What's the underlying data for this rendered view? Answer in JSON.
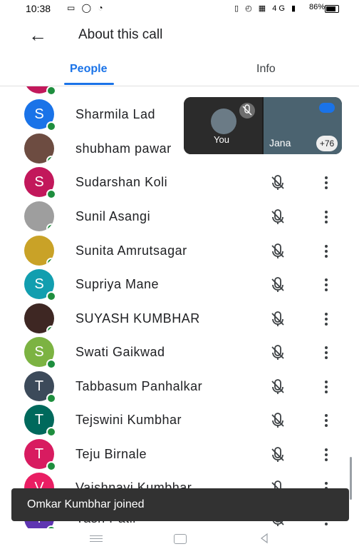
{
  "status_bar": {
    "time": "10:38",
    "battery": "86%",
    "network": "4G"
  },
  "header": {
    "title": "About this call"
  },
  "tabs": [
    {
      "label": "People",
      "active": true
    },
    {
      "label": "Info",
      "active": false
    }
  ],
  "participants": [
    {
      "initial": "",
      "name": "",
      "color": "#c2185b",
      "partial": true
    },
    {
      "initial": "S",
      "name": "Sharmila Lad",
      "color": "#1a73e8"
    },
    {
      "initial": "",
      "name": "shubham pawar",
      "color": "#6d4c41",
      "photo": true
    },
    {
      "initial": "S",
      "name": "Sudarshan Koli",
      "color": "#c2185b"
    },
    {
      "initial": "",
      "name": "Sunil Asangi",
      "color": "#9e9e9e",
      "photo": true
    },
    {
      "initial": "",
      "name": "Sunita Amrutsagar",
      "color": "#c9a227",
      "photo": true
    },
    {
      "initial": "S",
      "name": "Supriya Mane",
      "color": "#129eaf"
    },
    {
      "initial": "",
      "name": "SUYASH KUMBHAR",
      "color": "#3e2723",
      "photo": true
    },
    {
      "initial": "S",
      "name": "Swati Gaikwad",
      "color": "#7cb342"
    },
    {
      "initial": "T",
      "name": "Tabbasum Panhalkar",
      "color": "#3c4a5a"
    },
    {
      "initial": "T",
      "name": "Tejswini Kumbhar",
      "color": "#00695c"
    },
    {
      "initial": "T",
      "name": "Teju Birnale",
      "color": "#d81b60"
    },
    {
      "initial": "V",
      "name": "Vaishnavi Kumbhar",
      "color": "#e91e63"
    },
    {
      "initial": "Y",
      "name": "Yash Patil",
      "color": "#5e35b1"
    }
  ],
  "video_overlay": {
    "you_label": "You",
    "other_label": "Jana",
    "extra_count": "+76"
  },
  "toast": {
    "text": "Omkar Kumbhar joined"
  },
  "icons": {
    "back": "arrow-left-icon",
    "mic_off": "mic-off-icon",
    "more": "more-vert-icon"
  },
  "colors": {
    "accent": "#1a73e8",
    "online": "#1e8e3e"
  }
}
